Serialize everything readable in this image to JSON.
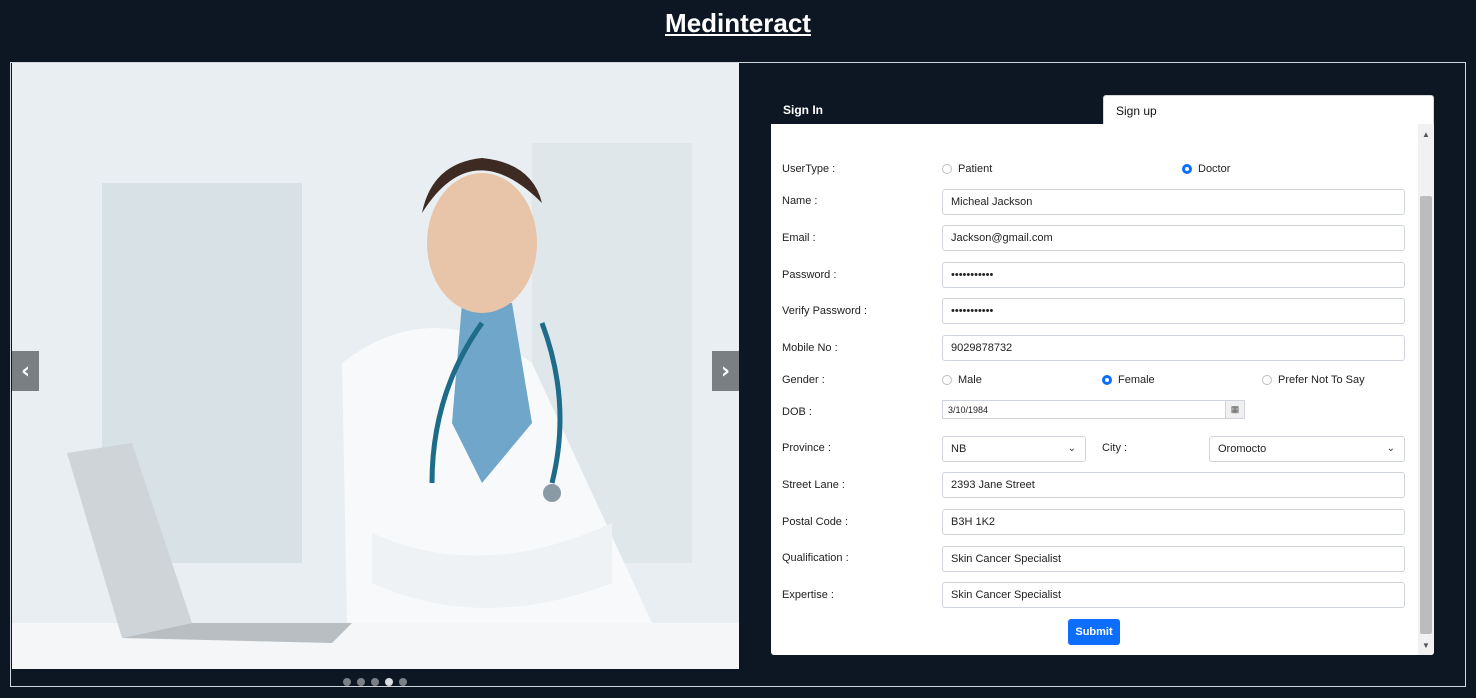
{
  "app": {
    "title": "Medinteract"
  },
  "carousel": {
    "prev_label": "‹",
    "next_label": "›",
    "active_slide": 4,
    "slide_count": 5,
    "image_description_icon": "doctor-photo"
  },
  "tabs": [
    {
      "label": "Sign In"
    },
    {
      "label": "Sign up"
    }
  ],
  "form": {
    "usertype": {
      "label": "UserType :",
      "options": [
        "Patient",
        "Doctor"
      ],
      "selected": "Doctor"
    },
    "name": {
      "label": "Name :",
      "value": "Micheal Jackson"
    },
    "email": {
      "label": "Email :",
      "value": "Jackson@gmail.com"
    },
    "password": {
      "label": "Password :",
      "value": "•••••••••••"
    },
    "verify_password": {
      "label": "Verify Password :",
      "value": "•••••••••••"
    },
    "mobile": {
      "label": "Mobile No :",
      "value": "9029878732"
    },
    "gender": {
      "label": "Gender :",
      "options": [
        "Male",
        "Female",
        "Prefer Not To Say"
      ],
      "selected": "Female"
    },
    "dob": {
      "label": "DOB :",
      "value": "3/10/1984"
    },
    "province": {
      "label": "Province :",
      "value": "NB"
    },
    "city": {
      "label": "City :",
      "value": "Oromocto"
    },
    "street": {
      "label": "Street Lane :",
      "value": "2393 Jane Street"
    },
    "postal": {
      "label": "Postal Code :",
      "value": "B3H 1K2"
    },
    "qualification": {
      "label": "Qualification :",
      "value": "Skin Cancer Specialist"
    },
    "expertise": {
      "label": "Expertise :",
      "value": "Skin Cancer Specialist"
    },
    "submit_label": "Submit"
  },
  "colors": {
    "background": "#0d1723",
    "accent": "#0d6efd"
  }
}
